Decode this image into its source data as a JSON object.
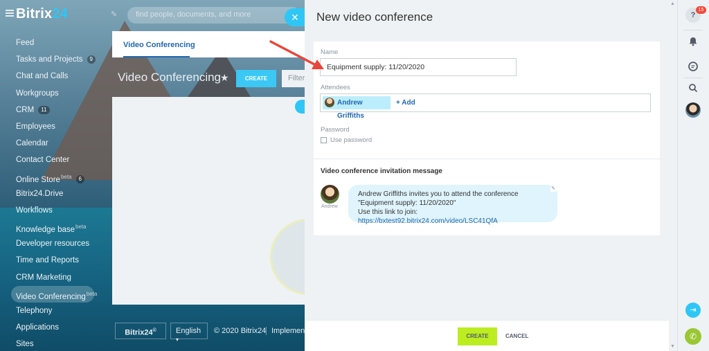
{
  "header": {
    "brand_main": "Bitrix",
    "brand_accent": "24",
    "search_placeholder": "find people, documents, and more"
  },
  "sidebar": {
    "items": [
      {
        "label": "Feed",
        "count": "",
        "sup": ""
      },
      {
        "label": "Tasks and Projects",
        "count": "9",
        "sup": ""
      },
      {
        "label": "Chat and Calls",
        "count": "",
        "sup": ""
      },
      {
        "label": "Workgroups",
        "count": "",
        "sup": ""
      },
      {
        "label": "CRM",
        "count": "11",
        "sup": ""
      },
      {
        "label": "Employees",
        "count": "",
        "sup": ""
      },
      {
        "label": "Calendar",
        "count": "",
        "sup": ""
      },
      {
        "label": "Contact Center",
        "count": "",
        "sup": ""
      },
      {
        "label": "Online Store",
        "count": "6",
        "sup": "beta"
      },
      {
        "label": "Bitrix24.Drive",
        "count": "",
        "sup": ""
      },
      {
        "label": "Workflows",
        "count": "",
        "sup": ""
      },
      {
        "label": "Knowledge base",
        "count": "",
        "sup": "beta"
      },
      {
        "label": "Developer resources",
        "count": "",
        "sup": ""
      },
      {
        "label": "Time and Reports",
        "count": "",
        "sup": ""
      },
      {
        "label": "CRM Marketing",
        "count": "",
        "sup": ""
      },
      {
        "label": "Video Conferencing",
        "count": "",
        "sup": "beta",
        "active": true
      },
      {
        "label": "Telephony",
        "count": "",
        "sup": ""
      },
      {
        "label": "Applications",
        "count": "",
        "sup": ""
      },
      {
        "label": "Sites",
        "count": "",
        "sup": ""
      }
    ]
  },
  "page": {
    "tab_label": "Video Conferencing",
    "title": "Video Conferencing",
    "create_label": "CREATE",
    "filter_placeholder": "Filter"
  },
  "footer": {
    "b24_label": "Bitrix24",
    "b24_mark": "©",
    "language": "English",
    "copyright": "© 2020 Bitrix24",
    "implementation": "Implementation"
  },
  "slider": {
    "title": "New video conference",
    "name_label": "Name",
    "name_value": "Equipment supply: 11/20/2020",
    "attendees_label": "Attendees",
    "attendee_name": "Andrew Griffiths",
    "add_label": "+ Add",
    "password_label": "Password",
    "use_password_label": "Use password",
    "invitation_heading": "Video conference invitation message",
    "avatar_caption": "Andrew",
    "message_line1": "Andrew Griffiths invites you to attend the conference",
    "message_line2": "\"Equipment supply: 11/20/2020\"",
    "message_line3_prefix": "Use this link to join: ",
    "message_link": "https://bxtest92.bitrix24.com/video/LSC41QfA",
    "create_button": "CREATE",
    "cancel_button": "CANCEL"
  },
  "rail": {
    "help_icon_glyph": "?",
    "notification_count": "15"
  },
  "colors": {
    "accent_blue": "#2fc6f6",
    "link_blue": "#2067b0",
    "create_green": "#bbed21",
    "badge_red": "#f5493d",
    "annotation_red": "#e8463b"
  }
}
